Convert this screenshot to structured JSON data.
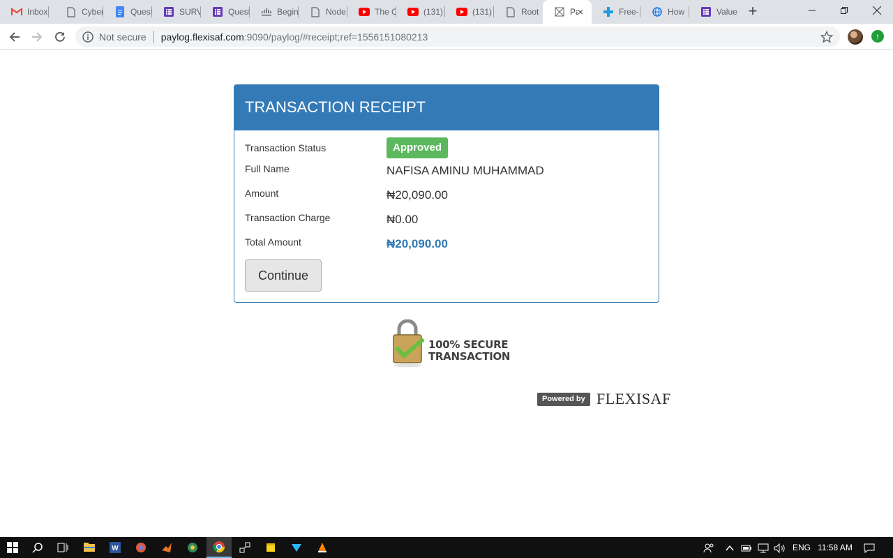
{
  "browser": {
    "tabs": [
      {
        "title": "Inbox",
        "icon": "gmail-icon",
        "color": "#ea4335"
      },
      {
        "title": "Cyber",
        "icon": "page-icon",
        "color": "#5f6368"
      },
      {
        "title": "Quest",
        "icon": "docs-icon",
        "color": "#4285f4"
      },
      {
        "title": "SURV",
        "icon": "forms-icon",
        "color": "#673ab7"
      },
      {
        "title": "Quest",
        "icon": "forms-icon",
        "color": "#673ab7"
      },
      {
        "title": "Begin",
        "icon": "cisco-icon",
        "color": "#5f6368"
      },
      {
        "title": "Node",
        "icon": "page-icon",
        "color": "#5f6368"
      },
      {
        "title": "The C",
        "icon": "youtube-icon",
        "color": "#ff0000"
      },
      {
        "title": "(131)",
        "icon": "youtube-icon",
        "color": "#ff0000"
      },
      {
        "title": "(131)",
        "icon": "youtube-icon",
        "color": "#ff0000"
      },
      {
        "title": "Root",
        "icon": "page-icon",
        "color": "#5f6368"
      },
      {
        "title": "Pa",
        "icon": "receipt-icon",
        "color": "#5f6368",
        "active": true
      },
      {
        "title": "Free-",
        "icon": "plus-cross-icon",
        "color": "#1a9be0"
      },
      {
        "title": "How",
        "icon": "globe-icon",
        "color": "#1a73e8"
      },
      {
        "title": "Value",
        "icon": "forms-icon",
        "color": "#673ab7"
      }
    ],
    "new_tab": "+",
    "close_tab": "×",
    "address": {
      "security": "Not secure",
      "host": "paylog.flexisaf.com",
      "path": ":9090/paylog/#receipt;ref=1556151080213"
    }
  },
  "receipt": {
    "title": "TRANSACTION RECEIPT",
    "rows": [
      {
        "label": "Transaction Status",
        "value": "Approved"
      },
      {
        "label": "Full Name",
        "value": "NAFISA AMINU MUHAMMAD"
      },
      {
        "label": "Amount",
        "value": "₦20,090.00"
      },
      {
        "label": "Transaction Charge",
        "value": "₦0.00"
      },
      {
        "label": "Total Amount",
        "value": "₦20,090.00"
      }
    ],
    "continue_label": "Continue",
    "accent": "#337ab7",
    "status_color": "#5cb85c"
  },
  "secure_badge": {
    "line1": "100% SECURE",
    "line2": "TRANSACTION"
  },
  "footer": {
    "powered_by": "Powered by",
    "brand": "FLEXISAF"
  },
  "taskbar": {
    "apps": [
      "start-icon",
      "search-icon",
      "task-view-icon",
      "file-explorer-icon",
      "word-icon",
      "app-icon",
      "matlab-icon",
      "app-icon",
      "chrome-icon",
      "network-icon",
      "sticky-notes-icon",
      "app-icon",
      "vlc-icon"
    ],
    "language": "ENG",
    "time": "11:58 AM"
  }
}
